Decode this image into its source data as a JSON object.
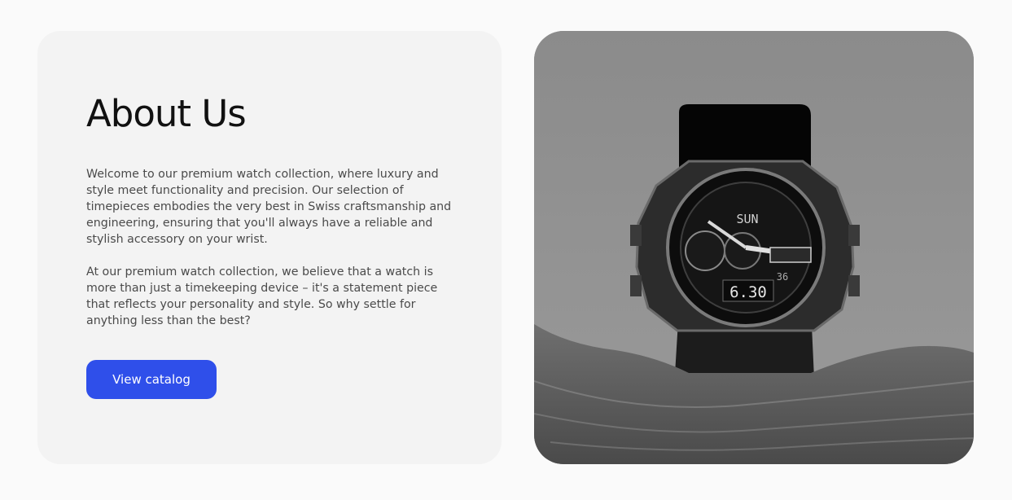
{
  "about": {
    "title": "About Us",
    "paragraph_1": "Welcome to our premium watch collection, where luxury and style meet functionality and precision. Our selection of timepieces embodies the very best in Swiss craftsmanship and engineering, ensuring that you'll always have a reliable and stylish accessory on your wrist.",
    "paragraph_2": "At our premium watch collection, we believe that a watch is more than just a timekeeping device – it's a statement piece that reflects your personality and style. So why settle for anything less than the best?",
    "button_label": "View catalog"
  },
  "photo": {
    "subject": "watch-photo",
    "watch_day": "SUN",
    "watch_time": "6.30",
    "watch_seconds": "36"
  },
  "colors": {
    "accent": "#2f4fea",
    "card_background": "#f3f3f3",
    "page_background": "#fafafa"
  }
}
